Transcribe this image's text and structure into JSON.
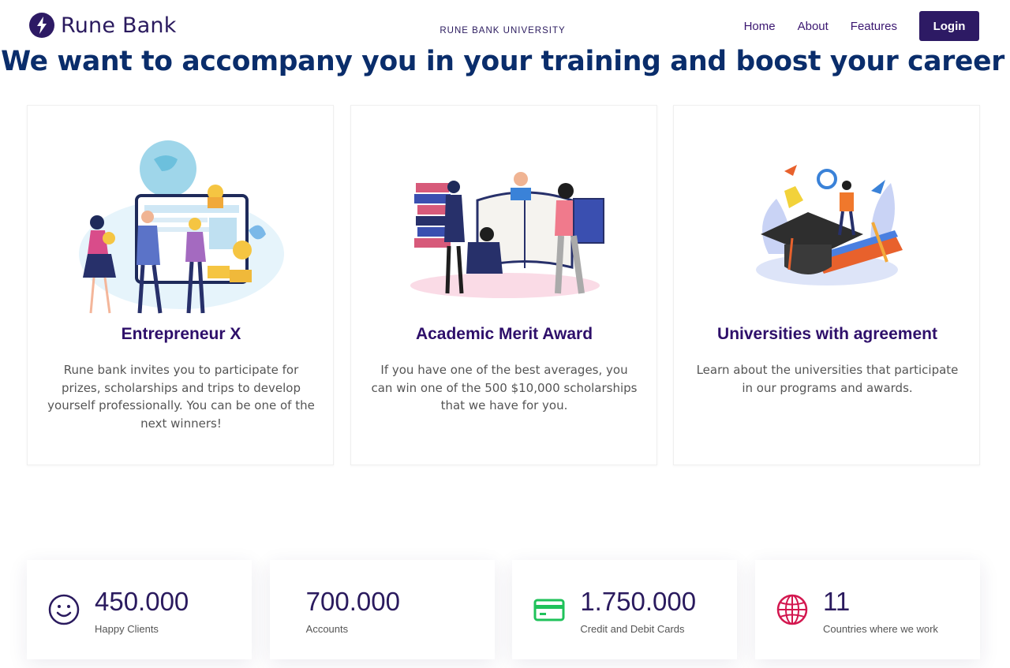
{
  "header": {
    "brand_name": "Rune Bank",
    "center_label": "RUNE BANK UNIVERSITY",
    "nav": [
      "Home",
      "About",
      "Features"
    ],
    "login_label": "Login"
  },
  "hero": {
    "title": "We want to accompany you in your training and boost your career"
  },
  "cards": [
    {
      "illustration": "team-finance-illustration",
      "title": "Entrepreneur X",
      "text": "Rune bank invites you to participate for prizes, scholarships and trips to develop yourself professionally. You can be one of the next winners!"
    },
    {
      "illustration": "students-reading-illustration",
      "title": "Academic Merit Award",
      "text": "If you have one of the best averages, you can win one of the 500 $10,000 scholarships that we have for you."
    },
    {
      "illustration": "graduation-cap-illustration",
      "title": "Universities with agreement",
      "text": "Learn about the universities that participate in our programs and awards."
    }
  ],
  "stats": [
    {
      "icon": "smiley-icon",
      "value": "450.000",
      "label": "Happy Clients",
      "color": "#2a1a5e"
    },
    {
      "icon": "",
      "value": "700.000",
      "label": "Accounts",
      "color": "#2a1a5e"
    },
    {
      "icon": "credit-card-icon",
      "value": "1.750.000",
      "label": "Credit and Debit Cards",
      "color": "#1fc25a"
    },
    {
      "icon": "globe-icon",
      "value": "11",
      "label": "Countries where we work",
      "color": "#d3174f"
    }
  ],
  "colors": {
    "brand": "#2d1a64",
    "title": "#0a2d6b",
    "card_title": "#2e0f6a"
  }
}
